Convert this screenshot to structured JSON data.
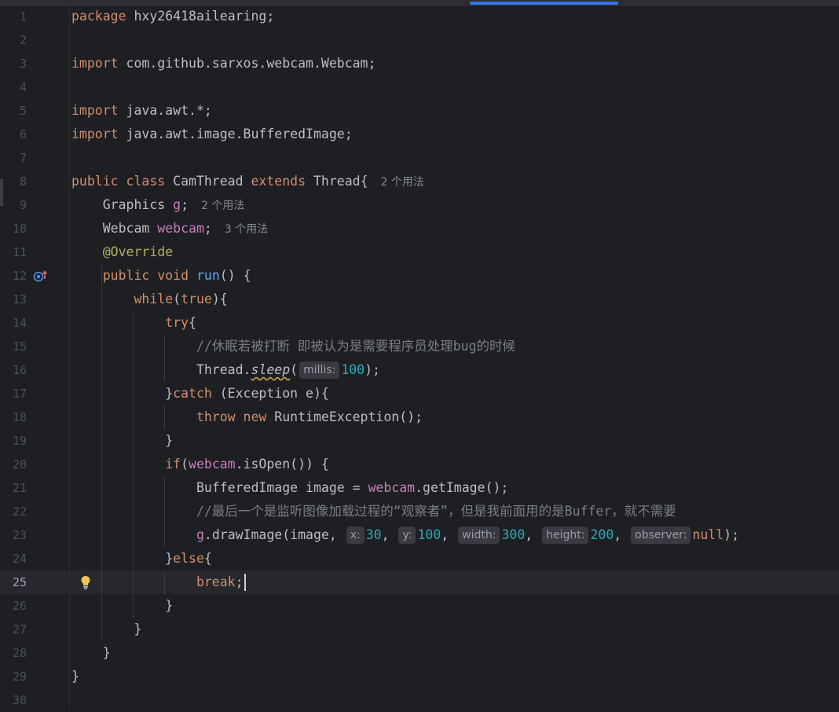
{
  "editor": {
    "current_line": 25,
    "lines": [
      {
        "n": "1",
        "tokens": [
          {
            "t": "package ",
            "c": "kw"
          },
          {
            "t": "hxy26418ailearing;",
            "c": "plain"
          }
        ]
      },
      {
        "n": "2",
        "tokens": []
      },
      {
        "n": "3",
        "tokens": [
          {
            "t": "import ",
            "c": "kw"
          },
          {
            "t": "com.github.sarxos.webcam.Webcam;",
            "c": "plain"
          }
        ]
      },
      {
        "n": "4",
        "tokens": []
      },
      {
        "n": "5",
        "tokens": [
          {
            "t": "import ",
            "c": "kw"
          },
          {
            "t": "java.awt.*;",
            "c": "plain"
          }
        ]
      },
      {
        "n": "6",
        "tokens": [
          {
            "t": "import ",
            "c": "kw"
          },
          {
            "t": "java.awt.image.BufferedImage;",
            "c": "plain"
          }
        ]
      },
      {
        "n": "7",
        "tokens": []
      },
      {
        "n": "8",
        "tokens": [
          {
            "t": "public class ",
            "c": "kw"
          },
          {
            "t": "CamThread ",
            "c": "plain"
          },
          {
            "t": "extends ",
            "c": "kw"
          },
          {
            "t": "Thread{",
            "c": "plain"
          },
          {
            "t": "2 个用法",
            "c": "usage"
          }
        ]
      },
      {
        "n": "9",
        "tokens": [
          {
            "t": "    Graphics ",
            "c": "plain"
          },
          {
            "t": "g",
            "c": "fld"
          },
          {
            "t": ";",
            "c": "plain"
          },
          {
            "t": "2 个用法",
            "c": "usage"
          }
        ]
      },
      {
        "n": "10",
        "tokens": [
          {
            "t": "    Webcam ",
            "c": "plain"
          },
          {
            "t": "webcam",
            "c": "fld"
          },
          {
            "t": ";",
            "c": "plain"
          },
          {
            "t": "3 个用法",
            "c": "usage"
          }
        ]
      },
      {
        "n": "11",
        "tokens": [
          {
            "t": "    @Override",
            "c": "ann"
          }
        ]
      },
      {
        "n": "12",
        "tokens": [
          {
            "t": "    public void ",
            "c": "kw"
          },
          {
            "t": "run",
            "c": "fn"
          },
          {
            "t": "() {",
            "c": "plain"
          }
        ]
      },
      {
        "n": "13",
        "tokens": [
          {
            "t": "        while",
            "c": "kw"
          },
          {
            "t": "(",
            "c": "plain"
          },
          {
            "t": "true",
            "c": "kw"
          },
          {
            "t": "){",
            "c": "plain"
          }
        ]
      },
      {
        "n": "14",
        "tokens": [
          {
            "t": "            try",
            "c": "kw"
          },
          {
            "t": "{",
            "c": "plain"
          }
        ]
      },
      {
        "n": "15",
        "tokens": [
          {
            "t": "                //休眠若被打断 即被认为是需要程序员处理bug的时候",
            "c": "cmt"
          }
        ]
      },
      {
        "n": "16",
        "tokens": [
          {
            "t": "                Thread.",
            "c": "plain"
          },
          {
            "t": "sleep",
            "c": "ital"
          },
          {
            "t": "(",
            "c": "plain"
          },
          {
            "t": "millis:",
            "c": "hint"
          },
          {
            "t": "100",
            "c": "num"
          },
          {
            "t": ");",
            "c": "plain"
          }
        ]
      },
      {
        "n": "17",
        "tokens": [
          {
            "t": "            }",
            "c": "plain"
          },
          {
            "t": "catch ",
            "c": "kw"
          },
          {
            "t": "(Exception e){",
            "c": "plain"
          }
        ]
      },
      {
        "n": "18",
        "tokens": [
          {
            "t": "                throw new ",
            "c": "kw"
          },
          {
            "t": "RuntimeException();",
            "c": "plain"
          }
        ]
      },
      {
        "n": "19",
        "tokens": [
          {
            "t": "            }",
            "c": "plain"
          }
        ]
      },
      {
        "n": "20",
        "tokens": [
          {
            "t": "            if",
            "c": "kw"
          },
          {
            "t": "(",
            "c": "plain"
          },
          {
            "t": "webcam",
            "c": "fld"
          },
          {
            "t": ".isOpen()) {",
            "c": "plain"
          }
        ]
      },
      {
        "n": "21",
        "tokens": [
          {
            "t": "                BufferedImage image = ",
            "c": "plain"
          },
          {
            "t": "webcam",
            "c": "fld"
          },
          {
            "t": ".getImage();",
            "c": "plain"
          }
        ]
      },
      {
        "n": "22",
        "tokens": [
          {
            "t": "                //最后一个是监听图像加载过程的“观察者”，但是我前面用的是Buffer，就不需要",
            "c": "cmt"
          }
        ]
      },
      {
        "n": "23",
        "tokens": [
          {
            "t": "                ",
            "c": "plain"
          },
          {
            "t": "g",
            "c": "fld"
          },
          {
            "t": ".drawImage(image, ",
            "c": "plain"
          },
          {
            "t": "x:",
            "c": "hint"
          },
          {
            "t": "30",
            "c": "num"
          },
          {
            "t": ", ",
            "c": "plain"
          },
          {
            "t": "y:",
            "c": "hint"
          },
          {
            "t": "100",
            "c": "num"
          },
          {
            "t": ", ",
            "c": "plain"
          },
          {
            "t": "width:",
            "c": "hint"
          },
          {
            "t": "300",
            "c": "num"
          },
          {
            "t": ", ",
            "c": "plain"
          },
          {
            "t": "height:",
            "c": "hint"
          },
          {
            "t": "200",
            "c": "num"
          },
          {
            "t": ", ",
            "c": "plain"
          },
          {
            "t": "observer:",
            "c": "hint"
          },
          {
            "t": "null",
            "c": "kw"
          },
          {
            "t": ");",
            "c": "plain"
          }
        ]
      },
      {
        "n": "24",
        "tokens": [
          {
            "t": "            }",
            "c": "plain"
          },
          {
            "t": "else",
            "c": "kw"
          },
          {
            "t": "{",
            "c": "plain"
          }
        ]
      },
      {
        "n": "25",
        "tokens": [
          {
            "t": "                break",
            "c": "kw"
          },
          {
            "t": ";",
            "c": "plain"
          }
        ]
      },
      {
        "n": "26",
        "tokens": [
          {
            "t": "            }",
            "c": "plain"
          }
        ]
      },
      {
        "n": "27",
        "tokens": [
          {
            "t": "        }",
            "c": "plain"
          }
        ]
      },
      {
        "n": "28",
        "tokens": [
          {
            "t": "    }",
            "c": "plain"
          }
        ]
      },
      {
        "n": "29",
        "tokens": [
          {
            "t": "}",
            "c": "plain"
          }
        ]
      },
      {
        "n": "30",
        "tokens": []
      }
    ]
  },
  "icons": {
    "gutter_override": "override-method-gutter-icon",
    "intention": "lightbulb-icon"
  },
  "colors": {
    "background": "#1e1f22",
    "current_line": "#26282e",
    "keyword": "#cf8e6d",
    "function": "#56a8f5",
    "field": "#c77dbb",
    "number": "#2aacb8",
    "comment": "#7a7e85",
    "annotation": "#b3ae60",
    "accent": "#3574f0"
  }
}
